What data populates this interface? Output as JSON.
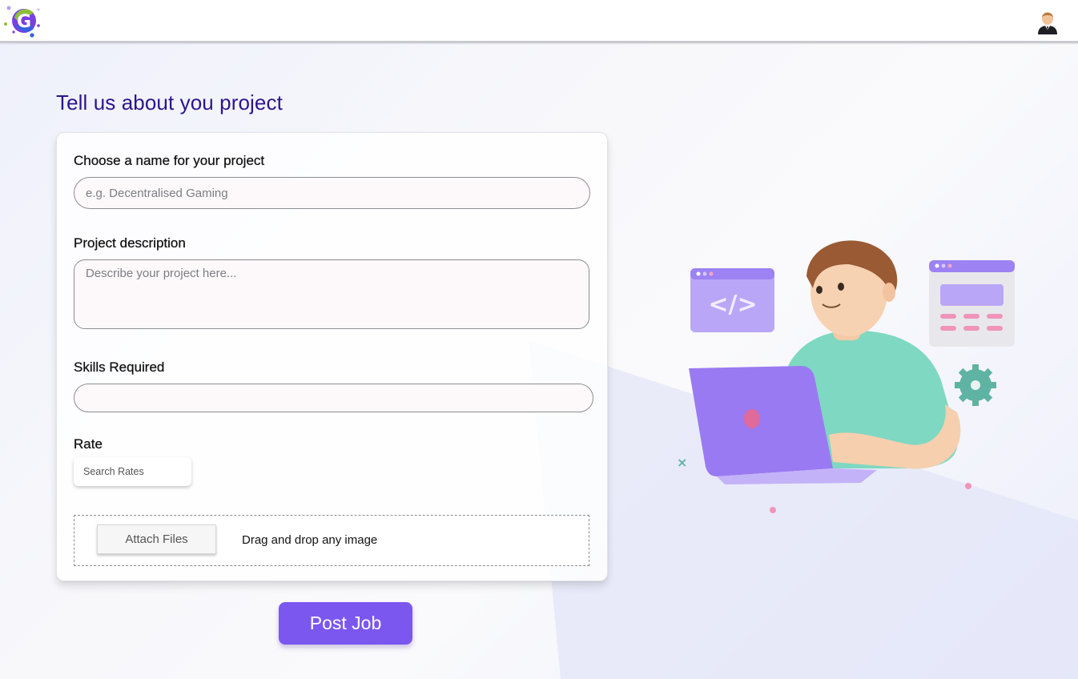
{
  "header": {
    "logo_icon": "g-logo-icon",
    "avatar_icon": "user-avatar-icon"
  },
  "page": {
    "title": "Tell us about you project"
  },
  "form": {
    "name_label": "Choose a name for your project",
    "name_placeholder": "e.g. Decentralised Gaming",
    "name_value": "",
    "description_label": "Project description",
    "description_placeholder": "Describe your project here...",
    "description_value": "",
    "skills_label": "Skills Required",
    "skills_value": "",
    "rate_label": "Rate",
    "rate_placeholder": "Search Rates",
    "attach_button_label": "Attach Files",
    "drop_text": "Drag and drop any image"
  },
  "actions": {
    "post_label": "Post Job"
  },
  "colors": {
    "accent": "#7b57f0",
    "title": "#2d148f"
  }
}
